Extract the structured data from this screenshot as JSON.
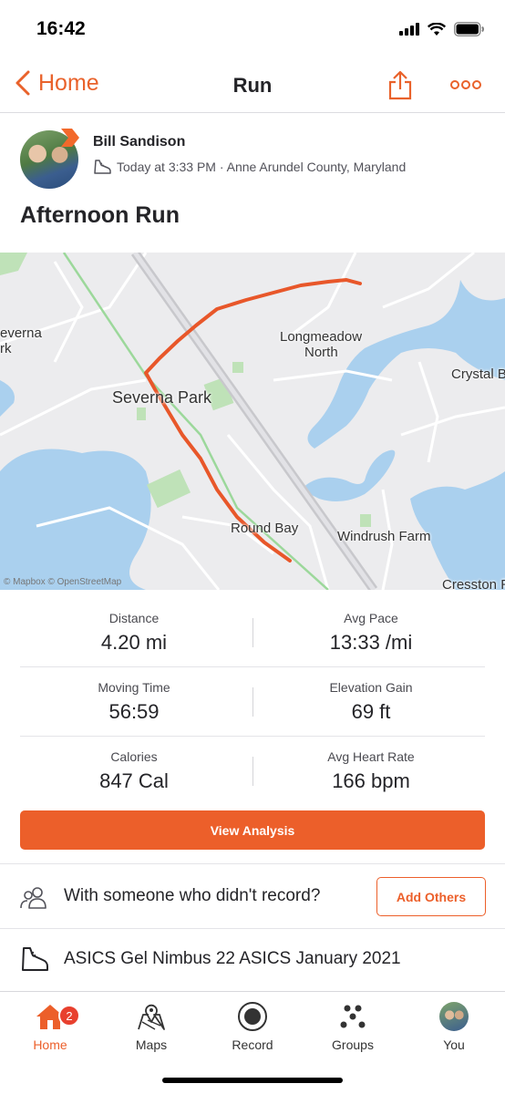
{
  "status_bar": {
    "time": "16:42"
  },
  "navbar": {
    "back_label": "Home",
    "title": "Run"
  },
  "athlete": {
    "name": "Bill Sandison",
    "meta": "Today at 3:33 PM · Anne Arundel County, Maryland"
  },
  "activity": {
    "title": "Afternoon Run"
  },
  "map": {
    "labels": {
      "severna_left": "everna",
      "severna_left2": "rk",
      "severna_park": "Severna Park",
      "longmeadow": "Longmeadow",
      "north": "North",
      "crystal": "Crystal B",
      "round_bay": "Round Bay",
      "windrush": "Windrush Farm",
      "cresston": "Cresston R"
    },
    "attribution": "© Mapbox © OpenStreetMap",
    "route_color": "#e8572a"
  },
  "stats": [
    {
      "label": "Distance",
      "value": "4.20 mi"
    },
    {
      "label": "Avg Pace",
      "value": "13:33 /mi"
    },
    {
      "label": "Moving Time",
      "value": "56:59"
    },
    {
      "label": "Elevation Gain",
      "value": "69 ft"
    },
    {
      "label": "Calories",
      "value": "847 Cal"
    },
    {
      "label": "Avg Heart Rate",
      "value": "166 bpm"
    }
  ],
  "actions": {
    "view_analysis": "View Analysis"
  },
  "others": {
    "text": "With someone who didn't record?",
    "button": "Add Others"
  },
  "gear": {
    "text": "ASICS Gel Nimbus 22 ASICS January 2021"
  },
  "tabbar": {
    "home": "Home",
    "home_badge": "2",
    "maps": "Maps",
    "record": "Record",
    "groups": "Groups",
    "you": "You"
  },
  "colors": {
    "accent": "#ec5f2a",
    "badge": "#e8402e"
  }
}
